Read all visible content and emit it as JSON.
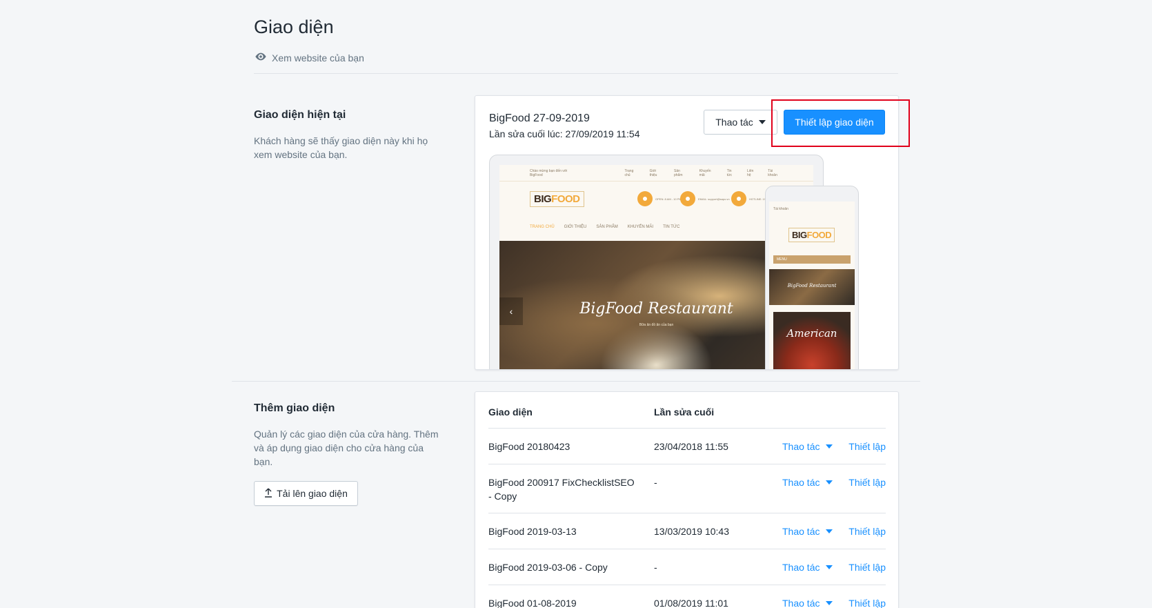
{
  "header": {
    "title": "Giao diện",
    "view_website": "Xem website của bạn"
  },
  "current": {
    "section_title": "Giao diện hiện tại",
    "section_desc": "Khách hàng sẽ thấy giao diện này khi họ xem website của bạn.",
    "theme_name": "BigFood 27-09-2019",
    "last_edit": "Lần sửa cuối lúc: 27/09/2019 11:54",
    "actions_label": "Thao tác",
    "customize_label": "Thiết lập giao diện",
    "preview": {
      "topbar_items": [
        "Chào mừng bạn đến với BigFood",
        "Trang chủ",
        "Giới thiệu",
        "Sản phẩm",
        "Khuyến mãi",
        "Tin tức",
        "Liên hệ",
        "Tài khoản"
      ],
      "logo_a": "BIG",
      "logo_b": "FOOD",
      "contact_items": [
        "OPEN: 8 AM - 10 PM",
        "EMAIL: support@sapo.vn",
        "HOTLINE: 19006750"
      ],
      "nav_items": [
        "TRANG CHỦ",
        "GIỚI THIỆU",
        "SẢN PHẨM",
        "KHUYẾN MÃI",
        "TIN TỨC"
      ],
      "hero_title": "BigFood Restaurant",
      "hero_sub": "Bữa ăn đồ ăn của bạn",
      "phone_account": "Tài khoản",
      "phone_menu": "MENU",
      "phone_hero": "BigFood Restaurant",
      "phone_card": "American"
    },
    "accent_color": "#1890ff"
  },
  "library": {
    "section_title": "Thêm giao diện",
    "section_desc": "Quản lý các giao diện của cửa hàng. Thêm và áp dụng giao diện cho cửa hàng của bạn.",
    "upload_label": "Tải lên giao diện",
    "col_theme": "Giao diện",
    "col_last_edit": "Lần sửa cuối",
    "rows": [
      {
        "name": "BigFood 20180423",
        "date": "23/04/2018 11:55",
        "action": "Thao tác",
        "set": "Thiết lập"
      },
      {
        "name": "BigFood 200917 FixChecklistSEO - Copy",
        "date": "-",
        "action": "Thao tác",
        "set": "Thiết lập"
      },
      {
        "name": "BigFood 2019-03-13",
        "date": "13/03/2019 10:43",
        "action": "Thao tác",
        "set": "Thiết lập"
      },
      {
        "name": "BigFood 2019-03-06 - Copy",
        "date": "-",
        "action": "Thao tác",
        "set": "Thiết lập"
      },
      {
        "name": "BigFood 01-08-2019",
        "date": "01/08/2019 11:01",
        "action": "Thao tác",
        "set": "Thiết lập"
      }
    ]
  }
}
